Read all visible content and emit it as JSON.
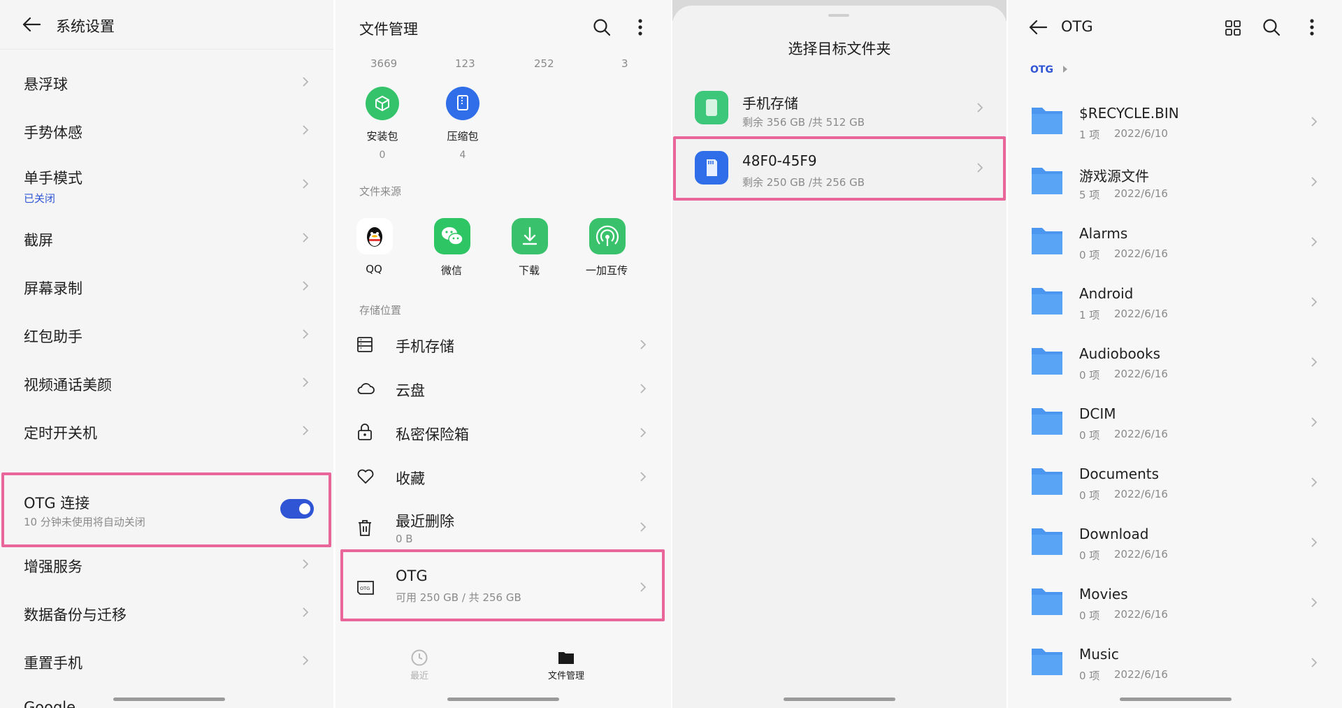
{
  "panel1": {
    "title": "系统设置",
    "items": [
      {
        "label": "悬浮球"
      },
      {
        "label": "手势体感"
      },
      {
        "label": "单手模式",
        "sub": "已关闭"
      },
      {
        "label": "截屏"
      },
      {
        "label": "屏幕录制"
      },
      {
        "label": "红包助手"
      },
      {
        "label": "视频通话美颜"
      },
      {
        "label": "定时开关机"
      }
    ],
    "otg": {
      "label": "OTG 连接",
      "sub": "10 分钟未使用将自动关闭",
      "toggle_on": true
    },
    "items2": [
      {
        "label": "增强服务"
      },
      {
        "label": "数据备份与迁移"
      },
      {
        "label": "重置手机"
      }
    ],
    "partial_label": "Google",
    "colors": {
      "accent": "#2f55d4",
      "highlight": "#e8669a"
    }
  },
  "panel2": {
    "title": "文件管理",
    "counts_top": [
      "3669",
      "123",
      "252",
      "3"
    ],
    "categories": [
      {
        "label": "安装包",
        "count": "0",
        "icon": "package-icon",
        "color": "#34c36a"
      },
      {
        "label": "压缩包",
        "count": "4",
        "icon": "zip-icon",
        "color": "#2f6ee8"
      }
    ],
    "sources_title": "文件来源",
    "sources": [
      {
        "label": "QQ",
        "icon": "qq-icon"
      },
      {
        "label": "微信",
        "icon": "wechat-icon",
        "color": "#2ec564"
      },
      {
        "label": "下载",
        "icon": "download-icon",
        "color": "#39c26b"
      },
      {
        "label": "一加互传",
        "icon": "share-icon",
        "color": "#39c26b"
      }
    ],
    "storage_title": "存储位置",
    "storage": [
      {
        "label": "手机存储",
        "icon": "storage-icon"
      },
      {
        "label": "云盘",
        "icon": "cloud-icon"
      },
      {
        "label": "私密保险箱",
        "icon": "lock-icon"
      },
      {
        "label": "收藏",
        "icon": "heart-icon"
      },
      {
        "label": "最近删除",
        "sub": "0 B",
        "icon": "trash-icon"
      }
    ],
    "otg": {
      "label": "OTG",
      "sub": "可用 250 GB / 共 256 GB",
      "badge": "OTG"
    },
    "nav": [
      {
        "label": "最近",
        "icon": "clock-icon"
      },
      {
        "label": "文件管理",
        "icon": "folder-icon"
      }
    ]
  },
  "panel3": {
    "title": "选择目标文件夹",
    "options": [
      {
        "name": "手机存储",
        "sub": "剩余 356 GB /共 512 GB",
        "icon": "phone-storage-icon",
        "color": "#3cc77a"
      },
      {
        "name": "48F0-45F9",
        "sub": "剩余 250 GB /共 256 GB",
        "icon": "sd-card-icon",
        "color": "#2f6ee8"
      }
    ]
  },
  "panel4": {
    "title": "OTG",
    "breadcrumb": "OTG",
    "folders": [
      {
        "name": "$RECYCLE.BIN",
        "count": "1 项",
        "date": "2022/6/10"
      },
      {
        "name": "游戏源文件",
        "count": "5 项",
        "date": "2022/6/16"
      },
      {
        "name": "Alarms",
        "count": "0 项",
        "date": "2022/6/16"
      },
      {
        "name": "Android",
        "count": "1 项",
        "date": "2022/6/16"
      },
      {
        "name": "Audiobooks",
        "count": "0 项",
        "date": "2022/6/16"
      },
      {
        "name": "DCIM",
        "count": "0 项",
        "date": "2022/6/16"
      },
      {
        "name": "Documents",
        "count": "0 项",
        "date": "2022/6/16"
      },
      {
        "name": "Download",
        "count": "0 项",
        "date": "2022/6/16"
      },
      {
        "name": "Movies",
        "count": "0 项",
        "date": "2022/6/16"
      },
      {
        "name": "Music",
        "count": "0 项",
        "date": "2022/6/16"
      }
    ],
    "folder_color": "#4b97f0"
  }
}
